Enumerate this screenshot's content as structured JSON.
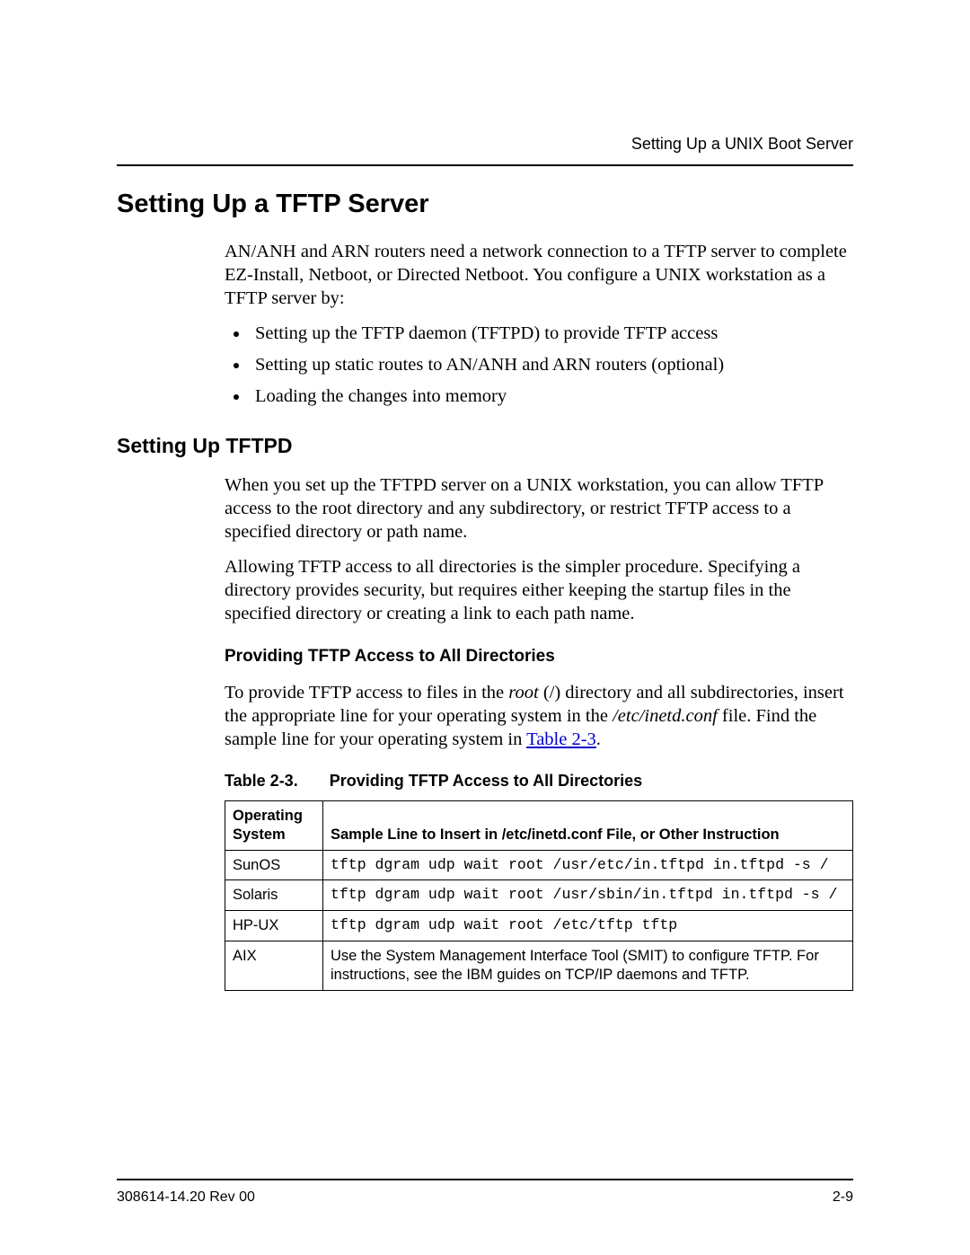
{
  "header": {
    "running_title": "Setting Up a UNIX Boot Server"
  },
  "h1": "Setting Up a TFTP Server",
  "intro_para": "AN/ANH and ARN routers need a network connection to a TFTP server to complete EZ-Install, Netboot, or Directed Netboot. You configure a UNIX workstation as a TFTP server by:",
  "intro_bullets": [
    "Setting up the TFTP daemon (TFTPD) to provide TFTP access",
    "Setting up static routes to AN/ANH and ARN routers (optional)",
    "Loading the changes into memory"
  ],
  "h2": "Setting Up TFTPD",
  "tftpd_para1": "When you set up the TFTPD server on a UNIX workstation, you can allow TFTP access to the root directory and any subdirectory, or restrict TFTP access to a specified directory or path name.",
  "tftpd_para2": "Allowing TFTP access to all directories is the simpler procedure. Specifying a directory provides security, but requires either keeping the startup files in the specified directory or creating a link to each path name.",
  "h3": "Providing TFTP Access to All Directories",
  "all_dirs_para": {
    "pre": "To provide TFTP access to files in the ",
    "root_i": "root",
    "mid1": " (/) directory and all subdirectories, insert the appropriate line for your operating system in the ",
    "file_i": "/etc/inetd.conf",
    "mid2": " file. Find the sample line for your operating system in ",
    "link": "Table 2-3",
    "post": "."
  },
  "table_caption": {
    "label": "Table 2-3.",
    "title": "Providing TFTP Access to All Directories"
  },
  "table": {
    "head": {
      "os": "Operating System",
      "line": "Sample Line to Insert in /etc/inetd.conf File, or Other Instruction"
    },
    "rows": [
      {
        "os": "SunOS",
        "line": "tftp dgram udp wait root /usr/etc/in.tftpd in.tftpd -s /",
        "mono": true
      },
      {
        "os": "Solaris",
        "line": "tftp dgram udp wait root /usr/sbin/in.tftpd in.tftpd -s /",
        "mono": true
      },
      {
        "os": "HP-UX",
        "line": "tftp dgram udp wait root /etc/tftp tftp",
        "mono": true
      },
      {
        "os": "AIX",
        "line": "Use the System Management Interface Tool (SMIT) to configure TFTP. For instructions, see the IBM guides on TCP/IP daemons and TFTP.",
        "mono": false
      }
    ]
  },
  "footer": {
    "doc_id": "308614-14.20 Rev 00",
    "page": "2-9"
  }
}
